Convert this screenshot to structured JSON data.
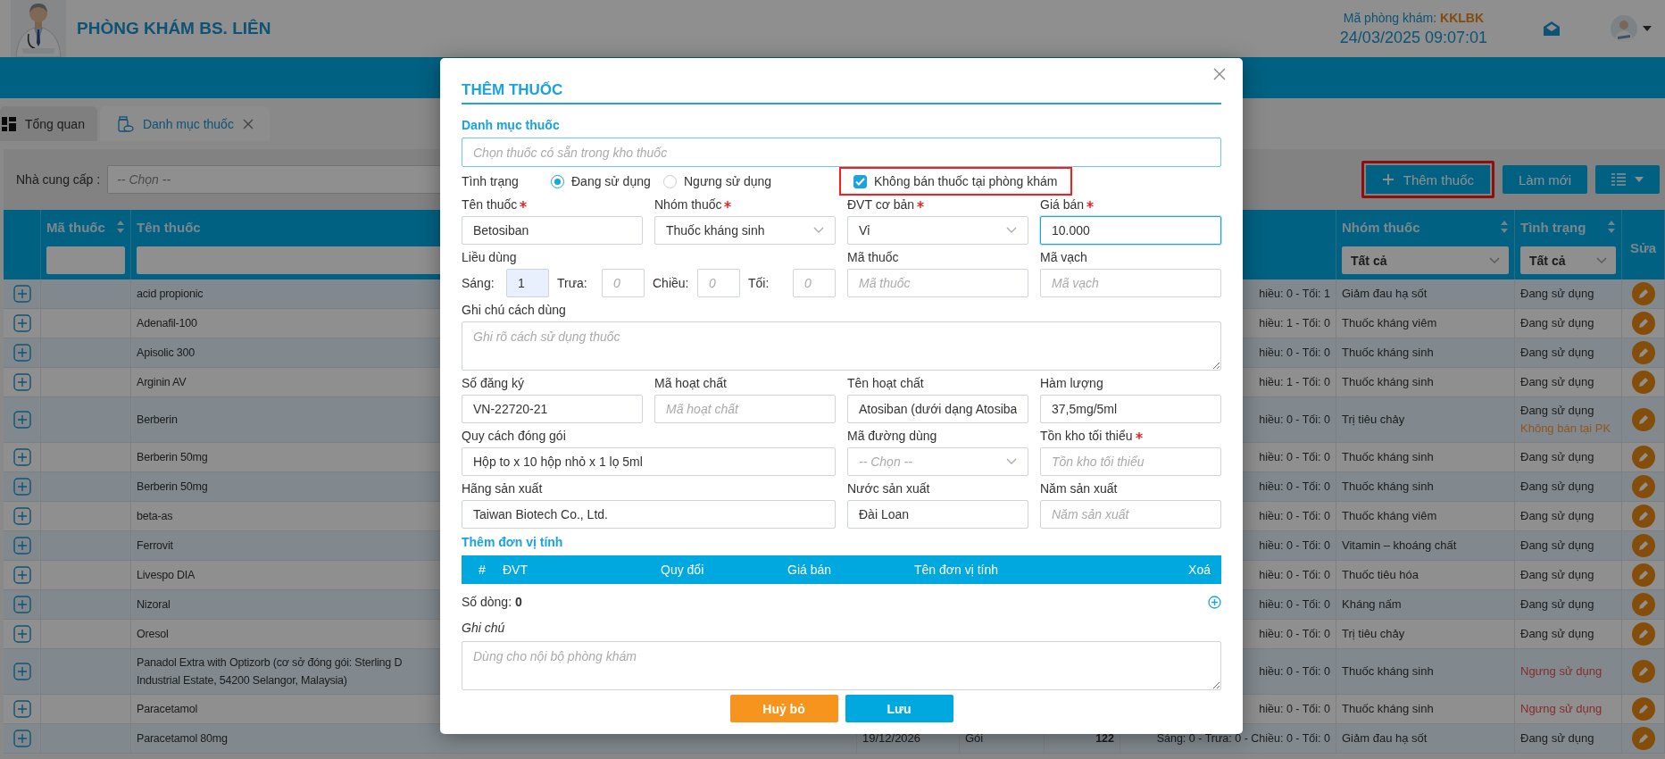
{
  "header": {
    "clinic_name": "PHÒNG KHÁM BS. LIÊN",
    "clinic_code_label": "Mã phòng khám:",
    "clinic_code": "KKLBK",
    "datetime": "24/03/2025 09:07:01"
  },
  "tabs": [
    {
      "label": "Tổng quan",
      "selected": false,
      "closable": false
    },
    {
      "label": "Danh mục thuốc",
      "selected": true,
      "closable": true
    }
  ],
  "filter": {
    "label": "Nhà cung cấp :",
    "placeholder": "-- Chọn --"
  },
  "toolbar": {
    "buttons": [
      {
        "kind": "add",
        "label": "Thêm thuốc",
        "highlighted": true
      },
      {
        "kind": "plain",
        "label": "Làm mới",
        "highlighted": false
      },
      {
        "kind": "columns",
        "highlighted": false
      }
    ]
  },
  "table": {
    "columns": [
      {
        "label": "Mã thuốc",
        "sortable": true,
        "kind": "input"
      },
      {
        "label": "Tên thuốc",
        "sortable": false,
        "kind": "input"
      },
      {
        "label": "Nhóm thuốc",
        "sortable": true,
        "kind": "dropdown",
        "filter_value": "Tất cả"
      },
      {
        "label": "Tình trạng",
        "sortable": true,
        "kind": "dropdown",
        "filter_value": "Tất cả"
      },
      {
        "label": "Sửa",
        "sortable": false,
        "kind": "plain"
      }
    ],
    "rows": [
      {
        "name": "acid propionic",
        "dosage": "hiều: 0 - Tối: 1",
        "group": "Giảm đau hạ sốt",
        "status": "Đang sử dụng",
        "active": true
      },
      {
        "name": "Adenafil-100",
        "dosage": "hiều: 1 - Tối: 0",
        "group": "Thuốc kháng viêm",
        "status": "Đang sử dụng",
        "active": true
      },
      {
        "name": "Apisolic 300",
        "dosage": "hiều: 0 - Tối: 0",
        "group": "Thuốc kháng sinh",
        "status": "Đang sử dụng",
        "active": true
      },
      {
        "name": "Arginin AV",
        "dosage": "hiều: 1 - Tối: 0",
        "group": "Thuốc kháng sinh",
        "status": "Đang sử dụng",
        "active": true
      },
      {
        "name": "Berberin",
        "dosage": "hiều: 0 - Tối: 0",
        "group": "Trị tiêu chảy",
        "status": "Đang sử dụng",
        "active": true,
        "note": "Không bán tại PK"
      },
      {
        "name": "Berberin 50mg",
        "dosage": "hiều: 0 - Tối: 0",
        "group": "Thuốc kháng sinh",
        "status": "Đang sử dụng",
        "active": true
      },
      {
        "name": "Berberin 50mg",
        "dosage": "hiều: 0 - Tối: 0",
        "group": "Thuốc kháng sinh",
        "status": "Đang sử dụng",
        "active": true
      },
      {
        "name": "beta-as",
        "dosage": "hiều: 0 - Tối: 0",
        "group": "Thuốc kháng viêm",
        "status": "Đang sử dụng",
        "active": true
      },
      {
        "name": "Ferrovit",
        "dosage": "hiều: 0 - Tối: 0",
        "group": "Vitamin – khoáng chất",
        "status": "Đang sử dụng",
        "active": true
      },
      {
        "name": "Livespo DIA",
        "dosage": "hiều: 0 - Tối: 0",
        "group": "Thuốc tiêu hóa",
        "status": "Đang sử dụng",
        "active": true
      },
      {
        "name": "Nizoral",
        "dosage": "hiều: 0 - Tối: 0",
        "group": "Kháng nấm",
        "status": "Đang sử dụng",
        "active": true
      },
      {
        "name": "Oresol",
        "dosage": "hiều: 0 - Tối: 0",
        "group": "Trị tiêu chảy",
        "status": "Đang sử dụng",
        "active": true
      },
      {
        "name": "Panadol Extra with Optizorb (cơ sở đóng gói: Sterling D\nIndustrial Estate, 54200 Selangor, Malaysia)",
        "dosage": "hiều: 0 - Tối: 0",
        "group": "Thuốc kháng sinh",
        "status": "Ngưng sử dụng",
        "active": false
      },
      {
        "name": "Paracetamol",
        "dosage": "hiều: 0 - Tối: 0",
        "group": "Thuốc kháng sinh",
        "status": "Ngưng sử dụng",
        "active": false
      },
      {
        "name": "Paracetamol 80mg",
        "expiry": "19/12/2026",
        "unit": "Gói",
        "stock": "122",
        "dosage": "Sáng: 0 - Trưa: 0 - Chiều: 0 - Tối: 0",
        "group": "Giảm đau hạ sốt",
        "status": "Đang sử dụng",
        "active": true
      }
    ]
  },
  "modal": {
    "title": "THÊM THUỐC",
    "catalog_label": "Danh mục thuốc",
    "catalog_placeholder": "Chọn thuốc có sẵn trong kho thuốc",
    "status_label": "Tình trạng",
    "status_options": [
      {
        "label": "Đang sử dụng",
        "selected": true
      },
      {
        "label": "Ngưng sử dụng",
        "selected": false
      }
    ],
    "not_sold": {
      "label": "Không bán thuốc tại phòng khám",
      "checked": true,
      "highlighted": true
    },
    "fields": [
      {
        "kind": "text",
        "label": "Tên thuốc",
        "required": true,
        "value": "Betosiban"
      },
      {
        "kind": "select",
        "label": "Nhóm thuốc",
        "required": true,
        "value": "Thuốc kháng sinh"
      },
      {
        "kind": "select",
        "label": "ĐVT cơ bản",
        "required": true,
        "value": "Vỉ"
      },
      {
        "kind": "text",
        "label": "Giá bán",
        "required": true,
        "value": "10.000",
        "focused": true
      },
      {
        "kind": "dosage",
        "label": "Liều dùng",
        "parts": [
          {
            "label": "Sáng:",
            "value": "1"
          },
          {
            "label": "Trưa:",
            "placeholder": "0"
          },
          {
            "label": "Chiều:",
            "placeholder": "0"
          },
          {
            "label": "Tối:",
            "placeholder": "0"
          }
        ]
      },
      {
        "kind": "text",
        "label": "Mã thuốc",
        "required": false,
        "placeholder": "Mã thuốc"
      },
      {
        "kind": "text",
        "label": "Mã vạch",
        "required": false,
        "placeholder": "Mã vạch"
      },
      {
        "kind": "textarea",
        "label": "Ghi chú cách dùng",
        "placeholder": "Ghi rõ cách sử dụng thuốc"
      },
      {
        "kind": "text",
        "label": "Số đăng ký",
        "required": false,
        "value": "VN-22720-21"
      },
      {
        "kind": "text",
        "label": "Mã hoạt chất",
        "required": false,
        "placeholder": "Mã hoạt chất"
      },
      {
        "kind": "text",
        "label": "Tên hoạt chất",
        "required": false,
        "value": "Atosiban (dưới dạng Atosiba"
      },
      {
        "kind": "text",
        "label": "Hàm lượng",
        "required": false,
        "value": "37,5mg/5ml"
      },
      {
        "kind": "wide",
        "label": "Quy cách đóng gói",
        "required": false,
        "value": "Hộp to x 10 hộp nhỏ x 1 lọ 5ml"
      },
      {
        "kind": "select",
        "label": "Mã đường dùng",
        "required": false,
        "placeholder": "-- Chọn --"
      },
      {
        "kind": "text",
        "label": "Tồn kho tối thiểu",
        "required": true,
        "placeholder": "Tồn kho tối thiểu"
      },
      {
        "kind": "wide",
        "label": "Hãng sản xuất",
        "required": false,
        "value": "Taiwan Biotech Co., Ltd."
      },
      {
        "kind": "text",
        "label": "Nước sản xuất",
        "required": false,
        "value": "Đài Loan"
      },
      {
        "kind": "text",
        "label": "Năm sản xuất",
        "required": false,
        "placeholder": "Năm sản xuất"
      }
    ],
    "units": {
      "title": "Thêm đơn vị tính",
      "columns": [
        "#",
        "ĐVT",
        "Quy đổi",
        "Giá bán",
        "Tên đơn vị tính",
        "Xoá"
      ],
      "row_count": "Số dòng: **0**"
    },
    "note": {
      "label": "Ghi chú",
      "placeholder": "Dùng cho nội bộ phòng khám"
    },
    "buttons": [
      {
        "kind": "cancel",
        "label": "Huỷ bỏ"
      },
      {
        "kind": "save",
        "label": "Lưu"
      }
    ]
  }
}
